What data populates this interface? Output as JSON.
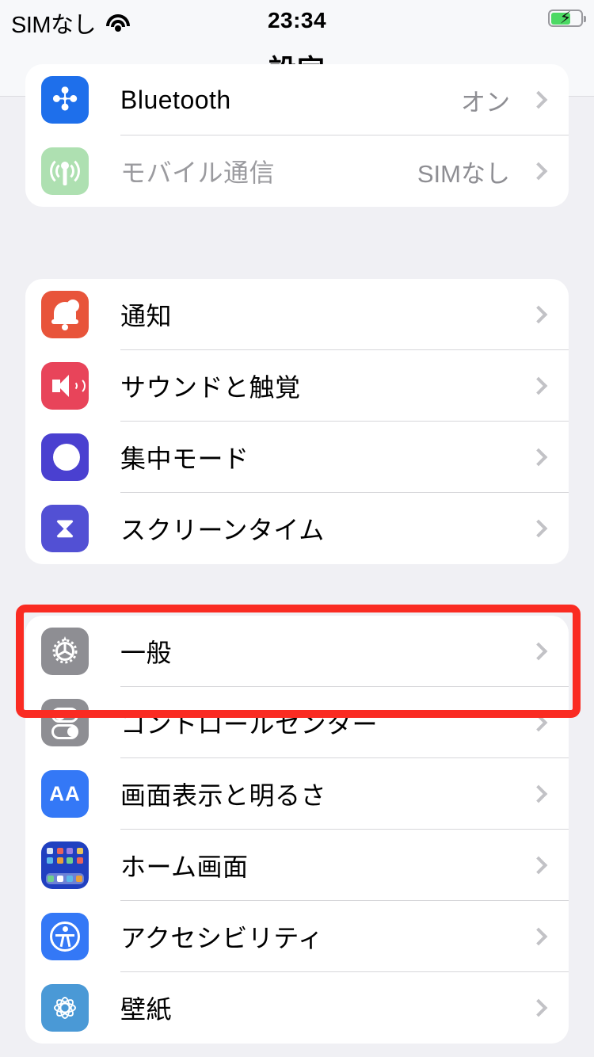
{
  "status_bar": {
    "carrier": "SIMなし",
    "wifi_icon": "wifi-icon",
    "time": "23:34",
    "battery_icon": "battery-charging-icon"
  },
  "nav_bar": {
    "title": "設定"
  },
  "colors": {
    "background": "#F0F0F4",
    "card": "#FFFFFF",
    "separator": "#D6D6DA",
    "secondary_text": "#8E8E93",
    "chevron": "#C2C2C6",
    "highlight": "#FA2B22"
  },
  "groups": [
    {
      "name": "connectivity",
      "rows": [
        {
          "label": "Bluetooth",
          "value": "オン",
          "icon": "bluetooth-icon",
          "icon_color": "#1E6FEB",
          "dimmed": false
        },
        {
          "label": "モバイル通信",
          "value": "SIMなし",
          "icon": "cellular-icon",
          "icon_color": "#AEE0B1",
          "dimmed": true
        }
      ]
    },
    {
      "name": "alerts",
      "rows": [
        {
          "label": "通知",
          "value": "",
          "icon": "notifications-bell-icon",
          "icon_color": "#E8543A",
          "dimmed": false
        },
        {
          "label": "サウンドと触覚",
          "value": "",
          "icon": "sound-speaker-icon",
          "icon_color": "#E8445A",
          "dimmed": false
        },
        {
          "label": "集中モード",
          "value": "",
          "icon": "focus-moon-icon",
          "icon_color": "#4A40D0",
          "dimmed": false
        },
        {
          "label": "スクリーンタイム",
          "value": "",
          "icon": "screen-time-hourglass-icon",
          "icon_color": "#5250D4",
          "dimmed": false
        }
      ]
    },
    {
      "name": "system",
      "rows": [
        {
          "label": "一般",
          "value": "",
          "icon": "general-gear-icon",
          "icon_color": "#8E8E93",
          "dimmed": false
        },
        {
          "label": "コントロールセンター",
          "value": "",
          "icon": "control-center-toggles-icon",
          "icon_color": "#8E8E93",
          "dimmed": false
        },
        {
          "label": "画面表示と明るさ",
          "value": "",
          "icon": "display-brightness-aa-icon",
          "icon_color": "#3478F6",
          "dimmed": false
        },
        {
          "label": "ホーム画面",
          "value": "",
          "icon": "home-screen-grid-icon",
          "icon_color": "#2040C0",
          "dimmed": false
        },
        {
          "label": "アクセシビリティ",
          "value": "",
          "icon": "accessibility-person-icon",
          "icon_color": "#3478F6",
          "dimmed": false
        },
        {
          "label": "壁紙",
          "value": "",
          "icon": "wallpaper-flower-icon",
          "icon_color": "#4A99D6",
          "dimmed": false
        }
      ]
    }
  ],
  "annotation": {
    "type": "highlight-rectangle",
    "target_label": "一般",
    "color": "#FA2B22"
  }
}
